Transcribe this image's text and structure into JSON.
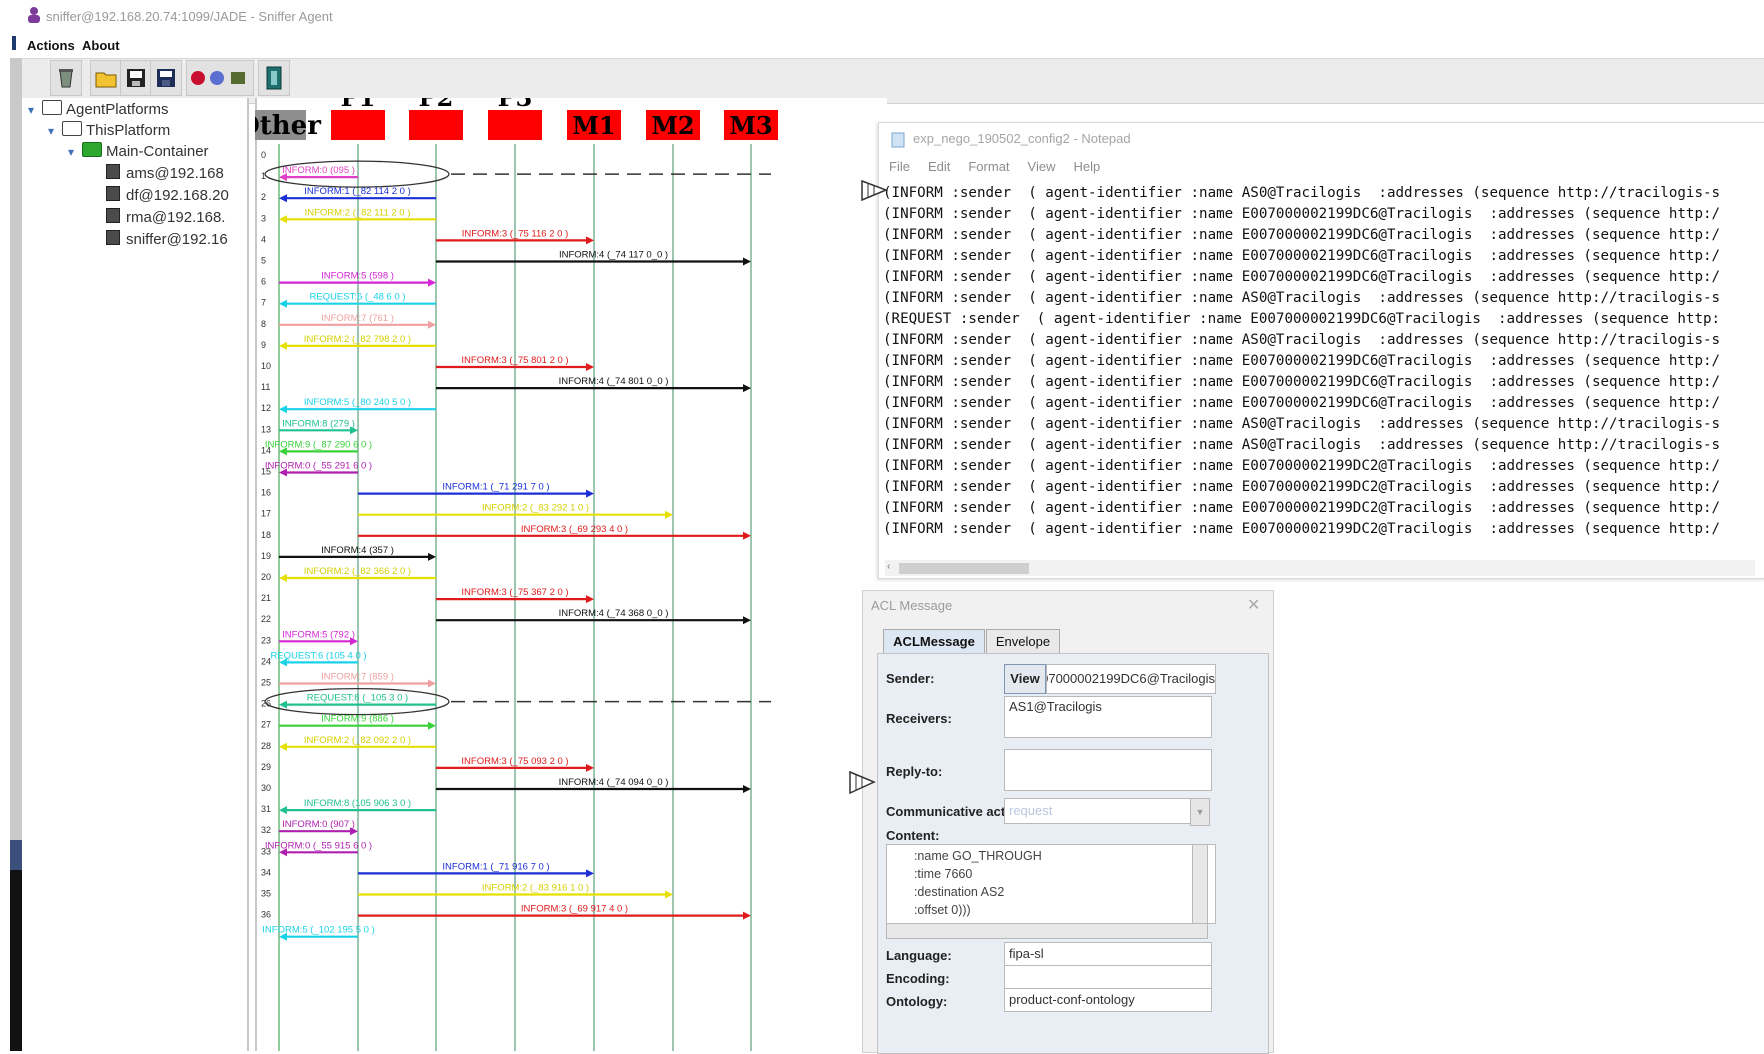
{
  "window": {
    "title": "sniffer@192.168.20.74:1099/JADE - Sniffer Agent"
  },
  "menu": {
    "items": [
      "Actions",
      "About"
    ]
  },
  "toolbar": {
    "icons": [
      "clear-canvas-icon",
      "open-icon",
      "write-icon",
      "save-icon",
      "record-icon",
      "refresh-icon",
      "filter-icon",
      "exit-icon"
    ]
  },
  "tree": {
    "root": "AgentPlatforms",
    "platform": "ThisPlatform",
    "container": "Main-Container",
    "agents": [
      "ams@192.168",
      "df@192.168.20",
      "rma@192.168.",
      "sniffer@192.16"
    ]
  },
  "sniffer": {
    "agents": [
      "Other",
      "P1",
      "P2",
      "P3",
      "M1",
      "M2",
      "M3"
    ],
    "row_numbers": [
      "0",
      "1",
      "2",
      "3",
      "4",
      "5",
      "6",
      "7",
      "8",
      "9",
      "10",
      "11",
      "12",
      "13",
      "14",
      "15",
      "16",
      "17",
      "18",
      "19",
      "20",
      "21",
      "22",
      "23",
      "24",
      "25",
      "26",
      "27",
      "28",
      "29",
      "30",
      "31",
      "32",
      "33",
      "34",
      "35",
      "36"
    ],
    "messages": [
      {
        "row": 1,
        "from": 1,
        "to": 0,
        "label": "INFORM:0 (095     )",
        "color": "#e040c8",
        "circled": true
      },
      {
        "row": 2,
        "from": 2,
        "to": 0,
        "label": "INFORM:1 (_82  114 2 0 )",
        "color": "#1a2fd6"
      },
      {
        "row": 3,
        "from": 2,
        "to": 0,
        "label": "INFORM:2 (_82  111 2 0 )",
        "color": "#e6e000"
      },
      {
        "row": 4,
        "from": 2,
        "to": 4,
        "label": "INFORM:3 (_75  116 2 0 )",
        "color": "#e01a1a"
      },
      {
        "row": 5,
        "from": 2,
        "to": 6,
        "label": "INFORM:4 (_74  117 0_0 )",
        "color": "#111111"
      },
      {
        "row": 6,
        "from": 0,
        "to": 2,
        "label": "INFORM:5 (598     )",
        "color": "#d426d4"
      },
      {
        "row": 7,
        "from": 2,
        "to": 0,
        "label": "REQUEST:6 (_48  6 0  )",
        "color": "#1ad2e8"
      },
      {
        "row": 8,
        "from": 0,
        "to": 2,
        "label": "INFORM:7 (761     )",
        "color": "#f0a0a0"
      },
      {
        "row": 9,
        "from": 2,
        "to": 0,
        "label": "INFORM:2 (_82  798 2 0 )",
        "color": "#e6e000"
      },
      {
        "row": 10,
        "from": 2,
        "to": 4,
        "label": "INFORM:3 (_75  801 2 0 )",
        "color": "#e01a1a"
      },
      {
        "row": 11,
        "from": 2,
        "to": 6,
        "label": "INFORM:4 (_74  801 0_0 )",
        "color": "#111111"
      },
      {
        "row": 12,
        "from": 2,
        "to": 0,
        "label": "INFORM:5 (_80  240 5 0 )",
        "color": "#1ad2e8"
      },
      {
        "row": 13,
        "from": 0,
        "to": 1,
        "label": "INFORM:8 (279     )",
        "color": "#20c090"
      },
      {
        "row": 14,
        "from": 1,
        "to": 0,
        "label": "INFORM:9 (_87  290 6 0 )",
        "color": "#3ad23a"
      },
      {
        "row": 15,
        "from": 1,
        "to": 0,
        "label": "INFORM:0 (_55  291 6 0 )",
        "color": "#b020b0"
      },
      {
        "row": 16,
        "from": 1,
        "to": 4,
        "label": "INFORM:1 (_71  291 7 0 )",
        "color": "#1a2fd6"
      },
      {
        "row": 17,
        "from": 1,
        "to": 5,
        "label": "INFORM:2 (_83  292 1 0 )",
        "color": "#e6e000"
      },
      {
        "row": 18,
        "from": 1,
        "to": 6,
        "label": "INFORM:3 (_69  293 4 0 )",
        "color": "#e01a1a"
      },
      {
        "row": 19,
        "from": 0,
        "to": 2,
        "label": "INFORM:4 (357     )",
        "color": "#111111"
      },
      {
        "row": 20,
        "from": 2,
        "to": 0,
        "label": "INFORM:2 (_82  366 2 0 )",
        "color": "#e6e000"
      },
      {
        "row": 21,
        "from": 2,
        "to": 4,
        "label": "INFORM:3 (_75  367 2 0 )",
        "color": "#e01a1a"
      },
      {
        "row": 22,
        "from": 2,
        "to": 6,
        "label": "INFORM:4 (_74  368 0_0 )",
        "color": "#111111"
      },
      {
        "row": 23,
        "from": 0,
        "to": 1,
        "label": "INFORM:5 (792     )",
        "color": "#d426d4"
      },
      {
        "row": 24,
        "from": 1,
        "to": 0,
        "label": "REQUEST:6 (105  4 0 )",
        "color": "#1ad2e8"
      },
      {
        "row": 25,
        "from": 0,
        "to": 2,
        "label": "INFORM:7 (859     )",
        "color": "#f0a0a0"
      },
      {
        "row": 26,
        "from": 2,
        "to": 0,
        "label": "REQUEST:8 (_105 3 0  )",
        "color": "#20c090",
        "circled": true
      },
      {
        "row": 27,
        "from": 0,
        "to": 2,
        "label": "INFORM:9 (886     )",
        "color": "#3ad23a"
      },
      {
        "row": 28,
        "from": 2,
        "to": 0,
        "label": "INFORM:2 (_82  092 2 0 )",
        "color": "#e6e000"
      },
      {
        "row": 29,
        "from": 2,
        "to": 4,
        "label": "INFORM:3 (_75  093 2 0 )",
        "color": "#e01a1a"
      },
      {
        "row": 30,
        "from": 2,
        "to": 6,
        "label": "INFORM:4 (_74  094 0_0 )",
        "color": "#111111"
      },
      {
        "row": 31,
        "from": 2,
        "to": 0,
        "label": "INFORM:8 (105  906 3 0 )",
        "color": "#20c090"
      },
      {
        "row": 32,
        "from": 0,
        "to": 1,
        "label": "INFORM:0 (907     )",
        "color": "#b020b0"
      },
      {
        "row": 33,
        "from": 1,
        "to": 0,
        "label": "INFORM:0 (_55  915 6 0 )",
        "color": "#b020b0"
      },
      {
        "row": 34,
        "from": 1,
        "to": 4,
        "label": "INFORM:1 (_71  916 7 0 )",
        "color": "#1a2fd6"
      },
      {
        "row": 35,
        "from": 1,
        "to": 5,
        "label": "INFORM:2 (_83  916 1 0 )",
        "color": "#e6e000"
      },
      {
        "row": 36,
        "from": 1,
        "to": 6,
        "label": "INFORM:3 (_69  917 4 0 )",
        "color": "#e01a1a"
      },
      {
        "row": 37,
        "from": 1,
        "to": 0,
        "label": "INFORM:5 (_102 195 5 0 )",
        "color": "#1ad2e8"
      }
    ]
  },
  "notepad": {
    "title": "exp_nego_190502_config2 - Notepad",
    "menu": [
      "File",
      "Edit",
      "Format",
      "View",
      "Help"
    ],
    "lines": [
      "(INFORM :sender  ( agent-identifier :name AS0@Tracilogis  :addresses (sequence http://tracilogis-s",
      "(INFORM :sender  ( agent-identifier :name E007000002199DC6@Tracilogis  :addresses (sequence http:/",
      "(INFORM :sender  ( agent-identifier :name E007000002199DC6@Tracilogis  :addresses (sequence http:/",
      "(INFORM :sender  ( agent-identifier :name E007000002199DC6@Tracilogis  :addresses (sequence http:/",
      "(INFORM :sender  ( agent-identifier :name E007000002199DC6@Tracilogis  :addresses (sequence http:/",
      "(INFORM :sender  ( agent-identifier :name AS0@Tracilogis  :addresses (sequence http://tracilogis-s",
      "(REQUEST :sender  ( agent-identifier :name E007000002199DC6@Tracilogis  :addresses (sequence http:",
      "(INFORM :sender  ( agent-identifier :name AS0@Tracilogis  :addresses (sequence http://tracilogis-s",
      "(INFORM :sender  ( agent-identifier :name E007000002199DC6@Tracilogis  :addresses (sequence http:/",
      "(INFORM :sender  ( agent-identifier :name E007000002199DC6@Tracilogis  :addresses (sequence http:/",
      "(INFORM :sender  ( agent-identifier :name E007000002199DC6@Tracilogis  :addresses (sequence http:/",
      "(INFORM :sender  ( agent-identifier :name AS0@Tracilogis  :addresses (sequence http://tracilogis-s",
      "(INFORM :sender  ( agent-identifier :name AS0@Tracilogis  :addresses (sequence http://tracilogis-s",
      "(INFORM :sender  ( agent-identifier :name E007000002199DC2@Tracilogis  :addresses (sequence http:/",
      "(INFORM :sender  ( agent-identifier :name E007000002199DC2@Tracilogis  :addresses (sequence http:/",
      "(INFORM :sender  ( agent-identifier :name E007000002199DC2@Tracilogis  :addresses (sequence http:/",
      "(INFORM :sender  ( agent-identifier :name E007000002199DC2@Tracilogis  :addresses (sequence http:/"
    ]
  },
  "acl": {
    "title": "ACL Message",
    "tabs": [
      "ACLMessage",
      "Envelope"
    ],
    "sender_label": "Sender:",
    "view_label": "View",
    "sender_value": "E007000002199DC6@Tracilogis",
    "receivers_label": "Receivers:",
    "receivers_value": "AS1@Tracilogis",
    "replyto_label": "Reply-to:",
    "comact_label": "Communicative act:",
    "comact_value": "request",
    "content_label": "Content:",
    "content_lines": [
      "  :name GO_THROUGH",
      "  :time 7660",
      "  :destination AS2",
      "  :offset 0)))"
    ],
    "language_label": "Language:",
    "language_value": "fipa-sl",
    "encoding_label": "Encoding:",
    "encoding_value": "",
    "ontology_label": "Ontology:",
    "ontology_value": "product-conf-ontology"
  }
}
